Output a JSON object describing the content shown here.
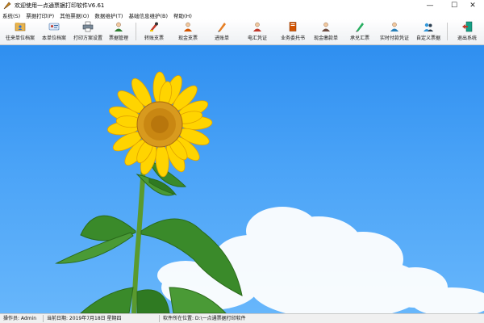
{
  "window": {
    "title": "欢迎使用一点通票据打印软件V6.61",
    "app_icon": "pen-icon",
    "controls": {
      "minimize": "—",
      "maximize": "☐",
      "close": "✕"
    }
  },
  "menu": [
    "系统(S)",
    "票据打印(P)",
    "其他票据(O)",
    "数据维护(T)",
    "基础信息维护(B)",
    "帮助(H)"
  ],
  "toolbar": {
    "buttons": [
      {
        "label": "往来单位档案",
        "icon": "contacts-folder-icon"
      },
      {
        "label": "本单位档案",
        "icon": "id-card-icon"
      },
      {
        "label": "打印方案设置",
        "icon": "printer-icon"
      },
      {
        "label": "票据管理",
        "icon": "manager-icon"
      },
      {
        "label": "转账支票",
        "icon": "transfer-check-icon"
      },
      {
        "label": "现金支票",
        "icon": "cash-check-icon"
      },
      {
        "label": "进账单",
        "icon": "deposit-slip-icon"
      },
      {
        "label": "电汇凭证",
        "icon": "wire-voucher-icon"
      },
      {
        "label": "业务委托书",
        "icon": "commission-book-icon"
      },
      {
        "label": "现金缴款单",
        "icon": "cash-payment-icon"
      },
      {
        "label": "承兑汇票",
        "icon": "acceptance-bill-icon"
      },
      {
        "label": "实时付款凭证",
        "icon": "realtime-payment-icon"
      },
      {
        "label": "自定义票据",
        "icon": "custom-bill-icon"
      },
      {
        "label": "退出系统",
        "icon": "exit-door-icon"
      }
    ]
  },
  "colors": {
    "sky_top": "#2f8ff0",
    "sky_bottom": "#67b6fb",
    "petal": "#ffd400",
    "flower_center": "#e0a020",
    "leaf": "#3a8a2a"
  },
  "status": {
    "operator": "操作员: Admin",
    "date": "当前日期: 2019年7月18日 星期四",
    "location": "软件所在位置: D:\\一点通票据打印软件"
  }
}
